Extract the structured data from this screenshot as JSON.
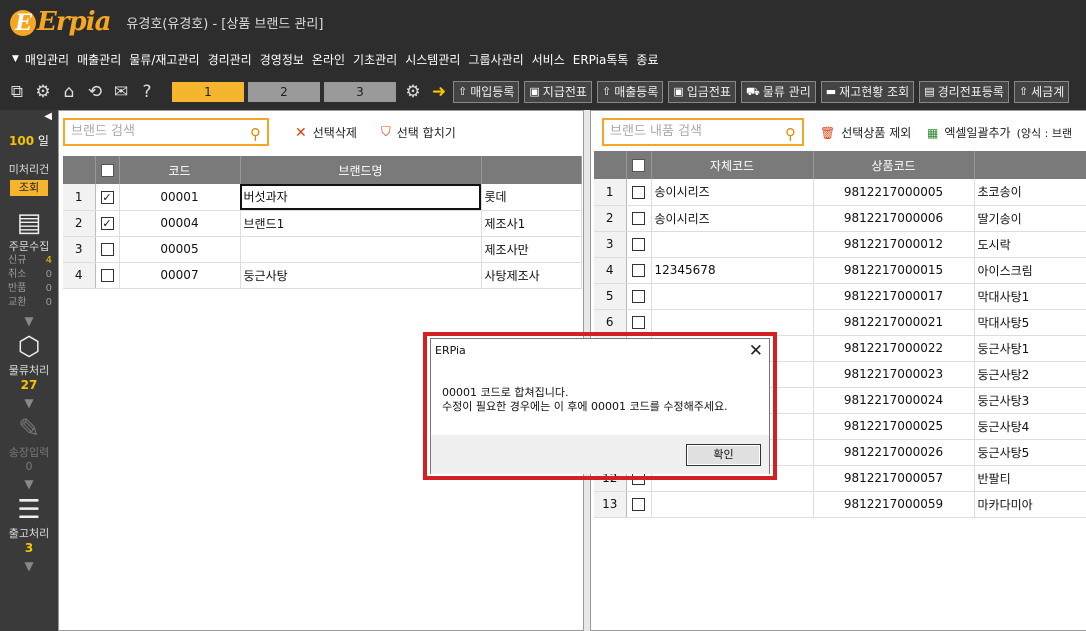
{
  "app": {
    "logo": "Erpia",
    "window_title": "유경호(유경호) - [상품 브랜드 관리]"
  },
  "menu": [
    "매입관리",
    "매출관리",
    "물류/재고관리",
    "경리관리",
    "경영정보",
    "온라인",
    "기초관리",
    "시스템관리",
    "그룹사관리",
    "서비스",
    "ERPia톡톡",
    "종료"
  ],
  "toolbar": {
    "page_tabs": [
      "1",
      "2",
      "3"
    ],
    "buttons": [
      "매입등록",
      "지급전표",
      "매출등록",
      "입금전표",
      "물류 관리",
      "재고현황 조회",
      "경리전표등록",
      "세금계"
    ]
  },
  "leftnav": {
    "days_value": "100",
    "days_unit": "일",
    "unprocessed_label": "미처리건",
    "lookup_button": "조회",
    "order_collect_label": "주문수집",
    "order_counts": [
      {
        "label": "신규",
        "value": "4"
      },
      {
        "label": "취소",
        "value": "0"
      },
      {
        "label": "반품",
        "value": "0"
      },
      {
        "label": "교환",
        "value": "0"
      }
    ],
    "logistics_label": "물류처리",
    "logistics_count": "27",
    "invoice_label": "송장입력",
    "invoice_count": "0",
    "shipping_label": "출고처리",
    "shipping_count": "3"
  },
  "brand_panel": {
    "search_placeholder": "브랜드 검색",
    "delete_selected": "선택삭제",
    "merge_selected": "선택 합치기",
    "columns": [
      "코드",
      "브랜드명"
    ],
    "rows": [
      {
        "n": "1",
        "checked": true,
        "code": "00001",
        "name": "버섯과자",
        "maker": "롯데"
      },
      {
        "n": "2",
        "checked": true,
        "code": "00004",
        "name": "브랜드1",
        "maker": "제조사1"
      },
      {
        "n": "3",
        "checked": false,
        "code": "00005",
        "name": "",
        "maker": "제조사만"
      },
      {
        "n": "4",
        "checked": false,
        "code": "00007",
        "name": "둥근사탕",
        "maker": "사탕제조사"
      }
    ]
  },
  "items_panel": {
    "search_placeholder": "브랜드 내품 검색",
    "exclude_selected": "선택상품 제외",
    "excel_bulk_add": "엑셀일괄추가",
    "format_label": "(양식 : 브랜",
    "columns": [
      "자체코드",
      "상품코드"
    ],
    "rows": [
      {
        "n": "1",
        "own": "송이시리즈",
        "code": "9812217000005",
        "name": "초코송이"
      },
      {
        "n": "2",
        "own": "송이시리즈",
        "code": "9812217000006",
        "name": "딸기송이"
      },
      {
        "n": "3",
        "own": "",
        "code": "9812217000012",
        "name": "도시락"
      },
      {
        "n": "4",
        "own": "12345678",
        "code": "9812217000015",
        "name": "아이스크림"
      },
      {
        "n": "5",
        "own": "",
        "code": "9812217000017",
        "name": "막대사탕1"
      },
      {
        "n": "6",
        "own": "",
        "code": "9812217000021",
        "name": "막대사탕5"
      },
      {
        "n": "",
        "own": "",
        "code": "9812217000022",
        "name": "둥근사탕1"
      },
      {
        "n": "",
        "own": "",
        "code": "9812217000023",
        "name": "둥근사탕2"
      },
      {
        "n": "",
        "own": "",
        "code": "9812217000024",
        "name": "둥근사탕3"
      },
      {
        "n": "",
        "own": "",
        "code": "9812217000025",
        "name": "둥근사탕4"
      },
      {
        "n": "",
        "own": "",
        "code": "9812217000026",
        "name": "둥근사탕5"
      },
      {
        "n": "12",
        "own": "",
        "code": "9812217000057",
        "name": "반팔티"
      },
      {
        "n": "13",
        "own": "",
        "code": "9812217000059",
        "name": "마카다미아"
      }
    ]
  },
  "dialog": {
    "title": "ERPia",
    "line1": "00001 코드로 합쳐집니다.",
    "line2": "수정이 필요한 경우에는 이 후에 00001 코드를 수정해주세요.",
    "ok": "확인"
  }
}
